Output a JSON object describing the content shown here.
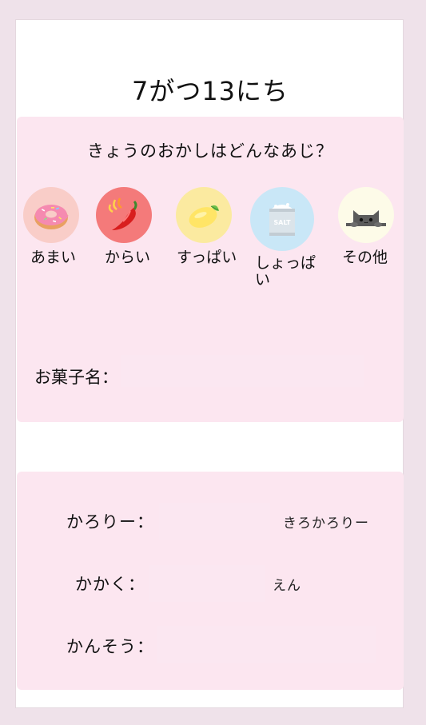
{
  "header": {
    "date_title": "7がつ13にち"
  },
  "taste_section": {
    "question": "きょうのおかしはどんなあじ？",
    "options": [
      {
        "label": "あまい",
        "icon": "donut-icon",
        "color": "#f9cdc8"
      },
      {
        "label": "からい",
        "icon": "chili-pepper-icon",
        "color": "#f47a7a"
      },
      {
        "label": "すっぱい",
        "icon": "lemon-icon",
        "color": "#fbeaa0"
      },
      {
        "label": "しょっぱい",
        "icon": "salt-bag-icon",
        "color": "#c9e7f7"
      },
      {
        "label": "その他",
        "icon": "cat-icon",
        "color": "#fdfbe8"
      }
    ],
    "salt_text": "SALT",
    "name_label": "お菓子名：",
    "name_value": ""
  },
  "details": {
    "calorie_label": "かろりー：",
    "calorie_unit": "きろかろりー",
    "price_label": "かかく：",
    "price_unit": "えん",
    "review_label": "かんそう："
  }
}
